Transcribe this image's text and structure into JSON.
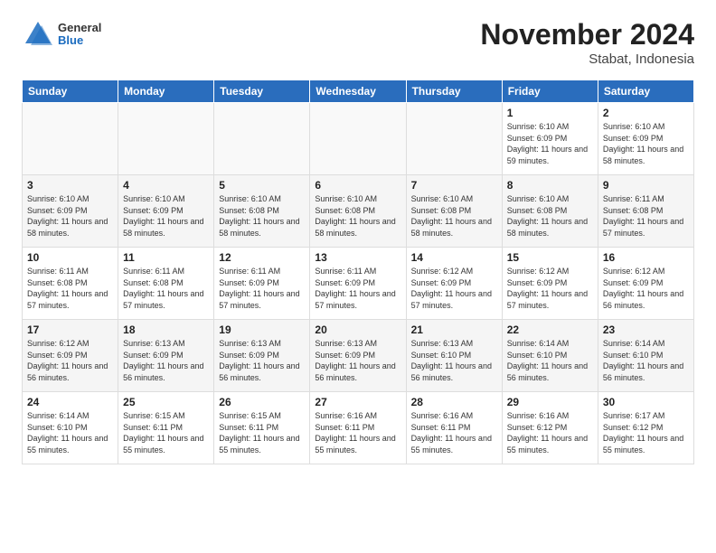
{
  "header": {
    "logo_general": "General",
    "logo_blue": "Blue",
    "month": "November 2024",
    "location": "Stabat, Indonesia"
  },
  "days": [
    "Sunday",
    "Monday",
    "Tuesday",
    "Wednesday",
    "Thursday",
    "Friday",
    "Saturday"
  ],
  "weeks": [
    [
      {
        "num": "",
        "info": ""
      },
      {
        "num": "",
        "info": ""
      },
      {
        "num": "",
        "info": ""
      },
      {
        "num": "",
        "info": ""
      },
      {
        "num": "",
        "info": ""
      },
      {
        "num": "1",
        "info": "Sunrise: 6:10 AM\nSunset: 6:09 PM\nDaylight: 11 hours and 59 minutes."
      },
      {
        "num": "2",
        "info": "Sunrise: 6:10 AM\nSunset: 6:09 PM\nDaylight: 11 hours and 58 minutes."
      }
    ],
    [
      {
        "num": "3",
        "info": "Sunrise: 6:10 AM\nSunset: 6:09 PM\nDaylight: 11 hours and 58 minutes."
      },
      {
        "num": "4",
        "info": "Sunrise: 6:10 AM\nSunset: 6:09 PM\nDaylight: 11 hours and 58 minutes."
      },
      {
        "num": "5",
        "info": "Sunrise: 6:10 AM\nSunset: 6:08 PM\nDaylight: 11 hours and 58 minutes."
      },
      {
        "num": "6",
        "info": "Sunrise: 6:10 AM\nSunset: 6:08 PM\nDaylight: 11 hours and 58 minutes."
      },
      {
        "num": "7",
        "info": "Sunrise: 6:10 AM\nSunset: 6:08 PM\nDaylight: 11 hours and 58 minutes."
      },
      {
        "num": "8",
        "info": "Sunrise: 6:10 AM\nSunset: 6:08 PM\nDaylight: 11 hours and 58 minutes."
      },
      {
        "num": "9",
        "info": "Sunrise: 6:11 AM\nSunset: 6:08 PM\nDaylight: 11 hours and 57 minutes."
      }
    ],
    [
      {
        "num": "10",
        "info": "Sunrise: 6:11 AM\nSunset: 6:08 PM\nDaylight: 11 hours and 57 minutes."
      },
      {
        "num": "11",
        "info": "Sunrise: 6:11 AM\nSunset: 6:08 PM\nDaylight: 11 hours and 57 minutes."
      },
      {
        "num": "12",
        "info": "Sunrise: 6:11 AM\nSunset: 6:09 PM\nDaylight: 11 hours and 57 minutes."
      },
      {
        "num": "13",
        "info": "Sunrise: 6:11 AM\nSunset: 6:09 PM\nDaylight: 11 hours and 57 minutes."
      },
      {
        "num": "14",
        "info": "Sunrise: 6:12 AM\nSunset: 6:09 PM\nDaylight: 11 hours and 57 minutes."
      },
      {
        "num": "15",
        "info": "Sunrise: 6:12 AM\nSunset: 6:09 PM\nDaylight: 11 hours and 57 minutes."
      },
      {
        "num": "16",
        "info": "Sunrise: 6:12 AM\nSunset: 6:09 PM\nDaylight: 11 hours and 56 minutes."
      }
    ],
    [
      {
        "num": "17",
        "info": "Sunrise: 6:12 AM\nSunset: 6:09 PM\nDaylight: 11 hours and 56 minutes."
      },
      {
        "num": "18",
        "info": "Sunrise: 6:13 AM\nSunset: 6:09 PM\nDaylight: 11 hours and 56 minutes."
      },
      {
        "num": "19",
        "info": "Sunrise: 6:13 AM\nSunset: 6:09 PM\nDaylight: 11 hours and 56 minutes."
      },
      {
        "num": "20",
        "info": "Sunrise: 6:13 AM\nSunset: 6:09 PM\nDaylight: 11 hours and 56 minutes."
      },
      {
        "num": "21",
        "info": "Sunrise: 6:13 AM\nSunset: 6:10 PM\nDaylight: 11 hours and 56 minutes."
      },
      {
        "num": "22",
        "info": "Sunrise: 6:14 AM\nSunset: 6:10 PM\nDaylight: 11 hours and 56 minutes."
      },
      {
        "num": "23",
        "info": "Sunrise: 6:14 AM\nSunset: 6:10 PM\nDaylight: 11 hours and 56 minutes."
      }
    ],
    [
      {
        "num": "24",
        "info": "Sunrise: 6:14 AM\nSunset: 6:10 PM\nDaylight: 11 hours and 55 minutes."
      },
      {
        "num": "25",
        "info": "Sunrise: 6:15 AM\nSunset: 6:11 PM\nDaylight: 11 hours and 55 minutes."
      },
      {
        "num": "26",
        "info": "Sunrise: 6:15 AM\nSunset: 6:11 PM\nDaylight: 11 hours and 55 minutes."
      },
      {
        "num": "27",
        "info": "Sunrise: 6:16 AM\nSunset: 6:11 PM\nDaylight: 11 hours and 55 minutes."
      },
      {
        "num": "28",
        "info": "Sunrise: 6:16 AM\nSunset: 6:11 PM\nDaylight: 11 hours and 55 minutes."
      },
      {
        "num": "29",
        "info": "Sunrise: 6:16 AM\nSunset: 6:12 PM\nDaylight: 11 hours and 55 minutes."
      },
      {
        "num": "30",
        "info": "Sunrise: 6:17 AM\nSunset: 6:12 PM\nDaylight: 11 hours and 55 minutes."
      }
    ]
  ]
}
